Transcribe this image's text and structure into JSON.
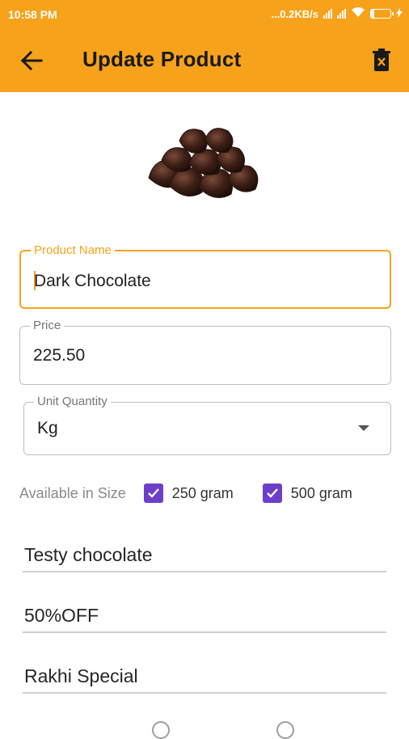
{
  "status_bar": {
    "time": "10:58 PM",
    "network_speed": "...0.2KB/s",
    "battery": "17",
    "battery_level": 0.17
  },
  "app_bar": {
    "title": "Update Product",
    "back_icon": "arrow-left-icon",
    "delete_icon": "trash-icon",
    "background_color": "#f7a21b"
  },
  "product": {
    "image_icon": "chocolate-pile-image",
    "name_label": "Product Name",
    "name_value": "Dark Chocolate",
    "price_label": "Price",
    "price_value": "225.50",
    "unit_label": "Unit Quantity",
    "unit_value": "Kg"
  },
  "sizes": {
    "label": "Available in Size",
    "options": [
      {
        "label": "250 gram",
        "checked": true
      },
      {
        "label": "500 gram",
        "checked": true
      }
    ],
    "checkbox_color": "#6d3fc9"
  },
  "text_fields": [
    {
      "value": "Testy chocolate"
    },
    {
      "value": "50%OFF"
    },
    {
      "value": "Rakhi Special"
    }
  ]
}
